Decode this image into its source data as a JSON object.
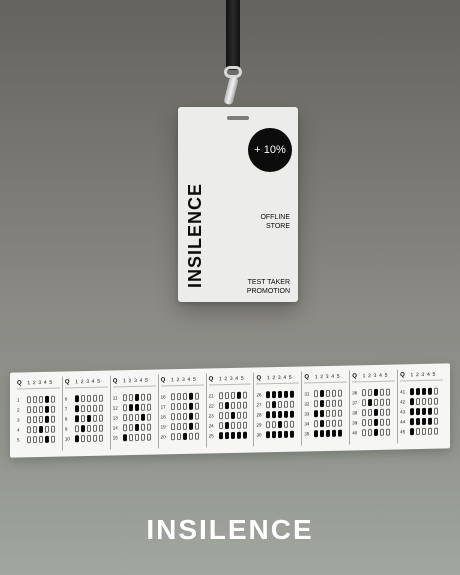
{
  "badge": {
    "promo": "+ 10%",
    "brand": "INSILENCE",
    "line1": "OFFLINE\nSTORE",
    "line2": "TEST TAKER\nPROMOTION"
  },
  "answer_sheet": {
    "header_q": "Q",
    "choice_numbers": [
      "1",
      "2",
      "3",
      "4",
      "5"
    ],
    "groups": [
      {
        "questions": [
          1,
          2,
          3,
          4,
          5
        ],
        "marks": [
          [
            0,
            0,
            0,
            1,
            0
          ],
          [
            0,
            0,
            0,
            1,
            0
          ],
          [
            0,
            0,
            0,
            1,
            0
          ],
          [
            0,
            0,
            1,
            0,
            0
          ],
          [
            0,
            0,
            0,
            1,
            0
          ]
        ]
      },
      {
        "questions": [
          6,
          7,
          8,
          9,
          10
        ],
        "marks": [
          [
            1,
            0,
            0,
            0,
            0
          ],
          [
            1,
            0,
            0,
            0,
            0
          ],
          [
            1,
            0,
            1,
            0,
            0
          ],
          [
            0,
            1,
            0,
            0,
            0
          ],
          [
            1,
            0,
            0,
            0,
            0
          ]
        ]
      },
      {
        "questions": [
          11,
          12,
          13,
          14,
          15
        ],
        "marks": [
          [
            0,
            0,
            1,
            0,
            0
          ],
          [
            0,
            1,
            1,
            0,
            0
          ],
          [
            0,
            0,
            0,
            1,
            0
          ],
          [
            0,
            0,
            1,
            0,
            0
          ],
          [
            1,
            0,
            0,
            0,
            0
          ]
        ]
      },
      {
        "questions": [
          16,
          17,
          18,
          19,
          20
        ],
        "marks": [
          [
            0,
            0,
            0,
            1,
            0
          ],
          [
            0,
            0,
            0,
            1,
            0
          ],
          [
            0,
            0,
            0,
            1,
            0
          ],
          [
            0,
            0,
            0,
            1,
            0
          ],
          [
            0,
            0,
            1,
            0,
            0
          ]
        ]
      },
      {
        "questions": [
          21,
          22,
          23,
          24,
          25
        ],
        "marks": [
          [
            0,
            0,
            0,
            1,
            0
          ],
          [
            0,
            1,
            0,
            0,
            0
          ],
          [
            0,
            0,
            1,
            0,
            0
          ],
          [
            0,
            1,
            0,
            0,
            0
          ],
          [
            1,
            1,
            1,
            1,
            1
          ]
        ]
      },
      {
        "questions": [
          26,
          27,
          28,
          29,
          30
        ],
        "marks": [
          [
            1,
            1,
            1,
            1,
            1
          ],
          [
            0,
            1,
            0,
            0,
            0
          ],
          [
            1,
            1,
            1,
            1,
            1
          ],
          [
            0,
            0,
            1,
            0,
            0
          ],
          [
            1,
            1,
            1,
            1,
            1
          ]
        ]
      },
      {
        "questions": [
          31,
          32,
          33,
          34,
          35
        ],
        "marks": [
          [
            0,
            1,
            0,
            0,
            0
          ],
          [
            0,
            1,
            0,
            0,
            0
          ],
          [
            1,
            1,
            0,
            0,
            0
          ],
          [
            0,
            1,
            0,
            0,
            0
          ],
          [
            1,
            1,
            1,
            1,
            1
          ]
        ]
      },
      {
        "questions": [
          36,
          37,
          38,
          39,
          40
        ],
        "marks": [
          [
            0,
            0,
            1,
            0,
            0
          ],
          [
            0,
            1,
            0,
            0,
            0
          ],
          [
            0,
            0,
            1,
            0,
            0
          ],
          [
            0,
            0,
            1,
            0,
            0
          ],
          [
            0,
            0,
            1,
            0,
            0
          ]
        ]
      },
      {
        "questions": [
          41,
          42,
          43,
          44,
          45
        ],
        "marks": [
          [
            1,
            1,
            1,
            1,
            0
          ],
          [
            1,
            0,
            0,
            0,
            0
          ],
          [
            1,
            1,
            1,
            1,
            0
          ],
          [
            1,
            1,
            1,
            1,
            0
          ],
          [
            1,
            0,
            0,
            0,
            0
          ]
        ]
      }
    ]
  },
  "footer": {
    "brand": "INSILENCE"
  },
  "colors": {
    "ink": "#0c0c0c",
    "card": "#ececea",
    "strip": "#f6f6f4",
    "footer_text": "#ffffff"
  }
}
